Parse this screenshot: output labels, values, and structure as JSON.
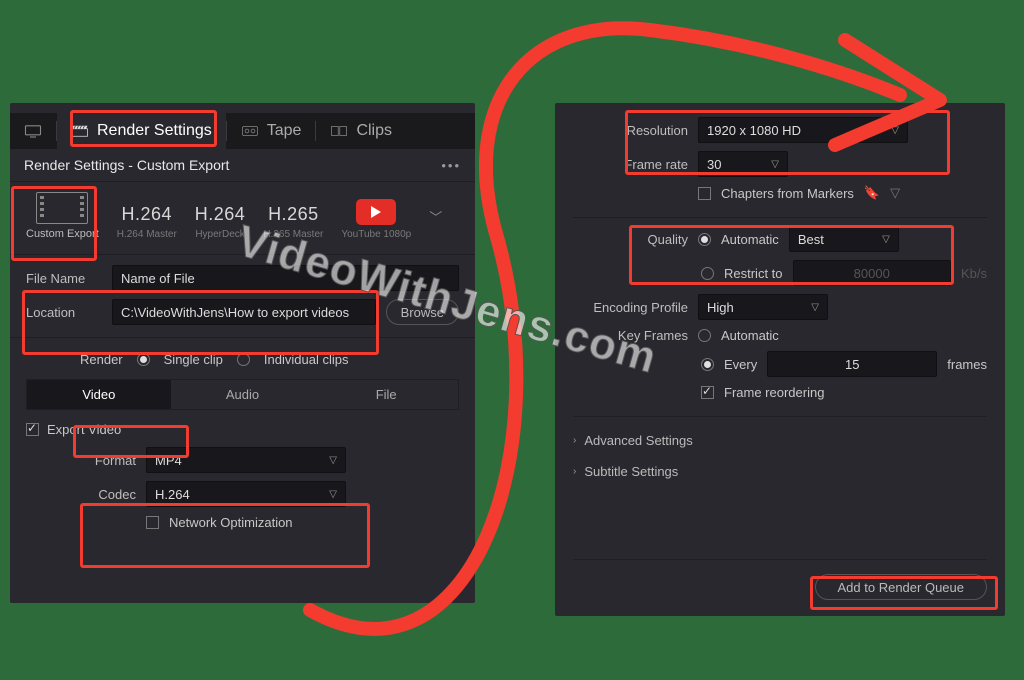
{
  "colors": {
    "highlight": "#f33b2f",
    "panel_bg": "#28282e"
  },
  "watermark": "VideoWithJens.com",
  "tabs": {
    "render_settings": "Render Settings",
    "tape": "Tape",
    "clips": "Clips"
  },
  "panel_left": {
    "title": "Render Settings - Custom Export",
    "presets": {
      "custom": {
        "label": "Custom Export"
      },
      "h264_master": {
        "big": "H.264",
        "sub": "H.264 Master"
      },
      "hyperdeck": {
        "big": "H.264",
        "sub": "HyperDeck"
      },
      "h265_master": {
        "big": "H.265",
        "sub": "H.265 Master"
      },
      "youtube": {
        "sub": "YouTube 1080p"
      }
    },
    "file_name_label": "File Name",
    "file_name_value": "Name of File",
    "location_label": "Location",
    "location_value": "C:\\VideoWithJens\\How to export videos",
    "browse": "Browse",
    "render_label": "Render",
    "single_clip": "Single clip",
    "individual_clips": "Individual clips",
    "subtabs": {
      "video": "Video",
      "audio": "Audio",
      "file": "File"
    },
    "export_video": "Export Video",
    "format_label": "Format",
    "format_value": "MP4",
    "codec_label": "Codec",
    "codec_value": "H.264",
    "network_opt": "Network Optimization"
  },
  "panel_right": {
    "resolution_label": "Resolution",
    "resolution_value": "1920 x 1080 HD",
    "frame_rate_label": "Frame rate",
    "frame_rate_value": "30",
    "chapters": "Chapters from Markers",
    "quality_label": "Quality",
    "quality_auto": "Automatic",
    "quality_value": "Best",
    "restrict_to": "Restrict to",
    "restrict_value": "80000",
    "kbs": "Kb/s",
    "encoding_profile_label": "Encoding Profile",
    "encoding_profile_value": "High",
    "key_frames_label": "Key Frames",
    "kf_auto": "Automatic",
    "kf_every": "Every",
    "kf_value": "15",
    "kf_frames": "frames",
    "frame_reorder": "Frame reordering",
    "advanced": "Advanced Settings",
    "subtitle": "Subtitle Settings",
    "add_to_queue": "Add to Render Queue"
  }
}
